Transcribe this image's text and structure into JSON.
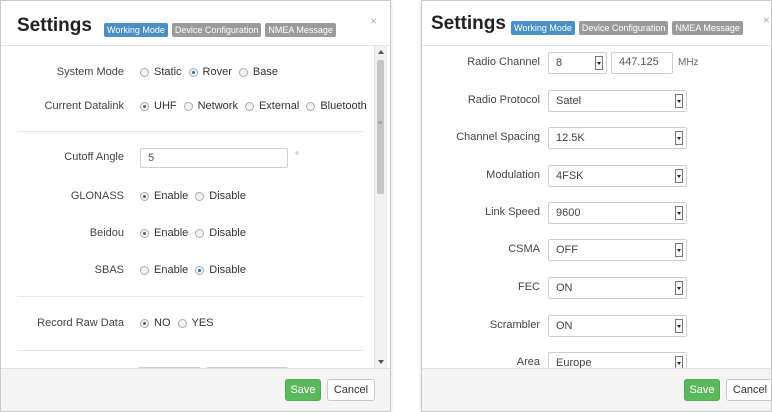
{
  "left_dialog": {
    "title": "Settings",
    "tabs": [
      {
        "label": "Working Mode",
        "active": true
      },
      {
        "label": "Device Configuration",
        "active": false
      },
      {
        "label": "NMEA Message",
        "active": false
      }
    ],
    "close_label": "×",
    "system_mode": {
      "label": "System Mode",
      "options": [
        "Static",
        "Rover",
        "Base"
      ],
      "selected": "Rover"
    },
    "current_datalink": {
      "label": "Current Datalink",
      "options": [
        "UHF",
        "Network",
        "External",
        "Bluetooth"
      ],
      "selected": "UHF"
    },
    "cutoff_angle": {
      "label": "Cutoff Angle",
      "value": "5",
      "unit": "°"
    },
    "glonass": {
      "label": "GLONASS",
      "options": [
        "Enable",
        "Disable"
      ],
      "selected": "Enable"
    },
    "beidou": {
      "label": "Beidou",
      "options": [
        "Enable",
        "Disable"
      ],
      "selected": "Enable"
    },
    "sbas": {
      "label": "SBAS",
      "options": [
        "Enable",
        "Disable"
      ],
      "selected": "Disable"
    },
    "record_raw_data": {
      "label": "Record Raw Data",
      "options": [
        "NO",
        "YES"
      ],
      "selected": "NO"
    },
    "save_label": "Save",
    "cancel_label": "Cancel"
  },
  "right_dialog": {
    "title": "Settings",
    "tabs": [
      {
        "label": "Working Mode",
        "active": true
      },
      {
        "label": "Device Configuration",
        "active": false
      },
      {
        "label": "NMEA Message",
        "active": false
      }
    ],
    "close_label": "×",
    "radio_channel": {
      "label": "Radio Channel",
      "value": "8",
      "frequency": "447.125",
      "unit": "MHz"
    },
    "radio_protocol": {
      "label": "Radio Protocol",
      "value": "Satel"
    },
    "channel_spacing": {
      "label": "Channel Spacing",
      "value": "12.5K"
    },
    "modulation": {
      "label": "Modulation",
      "value": "4FSK"
    },
    "link_speed": {
      "label": "Link Speed",
      "value": "9600"
    },
    "csma": {
      "label": "CSMA",
      "value": "OFF"
    },
    "fec": {
      "label": "FEC",
      "value": "ON"
    },
    "scrambler": {
      "label": "Scrambler",
      "value": "ON"
    },
    "area": {
      "label": "Area",
      "value": "Europe"
    },
    "save_label": "Save",
    "cancel_label": "Cancel"
  }
}
